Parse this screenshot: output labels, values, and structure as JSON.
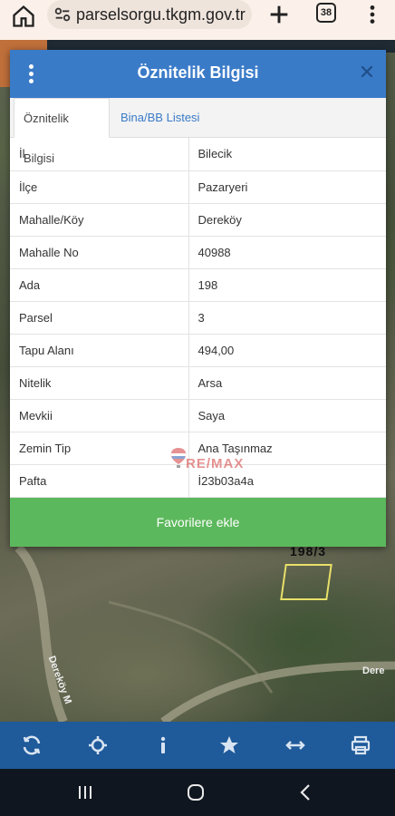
{
  "browser": {
    "url": "parselsorgu.tkgm.gov.tr",
    "tab_count": "38"
  },
  "map": {
    "parcel_label": "198/3",
    "road_labels": [
      "Dere",
      "Dereköy M"
    ]
  },
  "modal": {
    "title": "Öznitelik Bilgisi",
    "tabs": [
      {
        "label": "Öznitelik Bilgisi",
        "active": true
      },
      {
        "label": "Bina/BB Listesi",
        "active": false
      }
    ],
    "rows": [
      {
        "key": "İl",
        "value": "Bilecik"
      },
      {
        "key": "İlçe",
        "value": "Pazaryeri"
      },
      {
        "key": "Mahalle/Köy",
        "value": "Dereköy"
      },
      {
        "key": "Mahalle No",
        "value": "40988"
      },
      {
        "key": "Ada",
        "value": "198"
      },
      {
        "key": "Parsel",
        "value": "3"
      },
      {
        "key": "Tapu Alanı",
        "value": "494,00"
      },
      {
        "key": "Nitelik",
        "value": "Arsa"
      },
      {
        "key": "Mevkii",
        "value": "Saya"
      },
      {
        "key": "Zemin Tip",
        "value": "Ana Taşınmaz"
      },
      {
        "key": "Pafta",
        "value": "İ23b03a4a"
      }
    ],
    "favorite_button": "Favorilere ekle"
  },
  "watermark": {
    "text": "RE/MAX"
  },
  "colors": {
    "header_blue": "#3a7bc8",
    "favorite_green": "#5cb85c",
    "toolbar_blue": "#1f5a9a"
  },
  "toolbar": {
    "icons": [
      "refresh-icon",
      "locate-icon",
      "info-icon",
      "star-icon",
      "measure-icon",
      "print-icon"
    ]
  }
}
